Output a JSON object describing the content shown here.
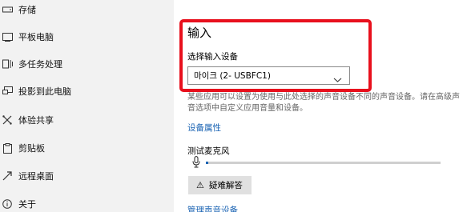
{
  "sidebar": {
    "items": [
      {
        "label": "存储",
        "icon": "storage-icon"
      },
      {
        "label": "平板电脑",
        "icon": "tablet-icon"
      },
      {
        "label": "多任务处理",
        "icon": "multitasking-icon"
      },
      {
        "label": "投影到此电脑",
        "icon": "project-icon"
      },
      {
        "label": "体验共享",
        "icon": "share-icon"
      },
      {
        "label": "剪贴板",
        "icon": "clipboard-icon"
      },
      {
        "label": "远程桌面",
        "icon": "remote-desktop-icon"
      },
      {
        "label": "关于",
        "icon": "info-icon"
      }
    ]
  },
  "input": {
    "title": "输入",
    "device_label": "选择输入设备",
    "device_value": "마이크 (2- USBFC1)",
    "description": "某些应用可以设置为使用与此处选择的声音设备不同的声音设备。请在高级声音选项中自定义应用音量和设备。",
    "device_properties_link": "设备属性",
    "mic_test_label": "测试麦克风",
    "mic_level": 0.01,
    "troubleshoot_label": "疑难解答",
    "manage_link": "管理声音设备"
  },
  "colors": {
    "accent": "#1a63b3",
    "highlight": "#e8101d",
    "sidebar_bg": "#f2f2f2"
  }
}
